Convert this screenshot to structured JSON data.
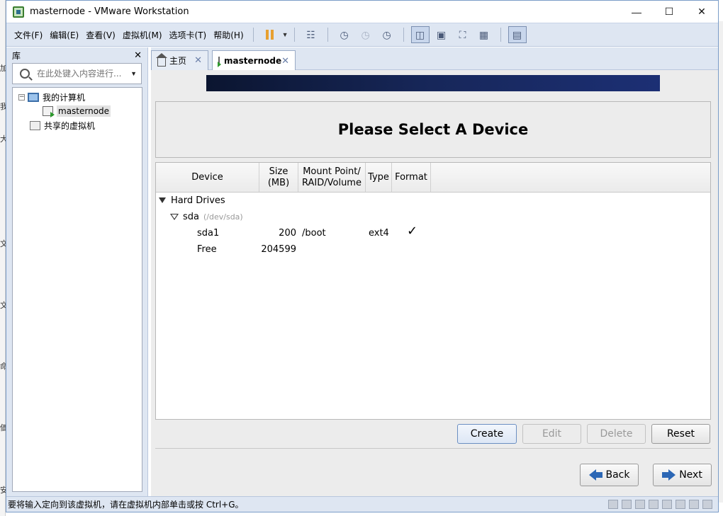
{
  "window": {
    "title": "masternode - VMware Workstation"
  },
  "background_fragments": [
    "加",
    "我",
    "大",
    "文",
    "文",
    "命",
    "価",
    "安"
  ],
  "menu": [
    "文件(F)",
    "编辑(E)",
    "查看(V)",
    "虚拟机(M)",
    "选项卡(T)",
    "帮助(H)"
  ],
  "library": {
    "title": "库",
    "search_placeholder": "在此处键入内容进行...",
    "my_computer": "我的计算机",
    "vm": "masternode",
    "shared": "共享的虚拟机"
  },
  "tabs": {
    "home": "主页",
    "vm": "masternode"
  },
  "installer": {
    "heading": "Please Select A Device",
    "columns": {
      "device": "Device",
      "size_l1": "Size",
      "size_l2": "(MB)",
      "mount_l1": "Mount Point/",
      "mount_l2": "RAID/Volume",
      "type": "Type",
      "format": "Format"
    },
    "group": "Hard Drives",
    "disk": {
      "name": "sda",
      "path": "(/dev/sda)"
    },
    "partitions": [
      {
        "device": "sda1",
        "size": "200",
        "mount": "/boot",
        "type": "ext4",
        "format": "✓"
      },
      {
        "device": "Free",
        "size": "204599",
        "mount": "",
        "type": "",
        "format": ""
      }
    ],
    "buttons": {
      "create": "Create",
      "edit": "Edit",
      "delete": "Delete",
      "reset": "Reset",
      "back": "Back",
      "next": "Next"
    }
  },
  "status": "要将输入定向到该虚拟机，请在虚拟机内部单击或按 Ctrl+G。"
}
